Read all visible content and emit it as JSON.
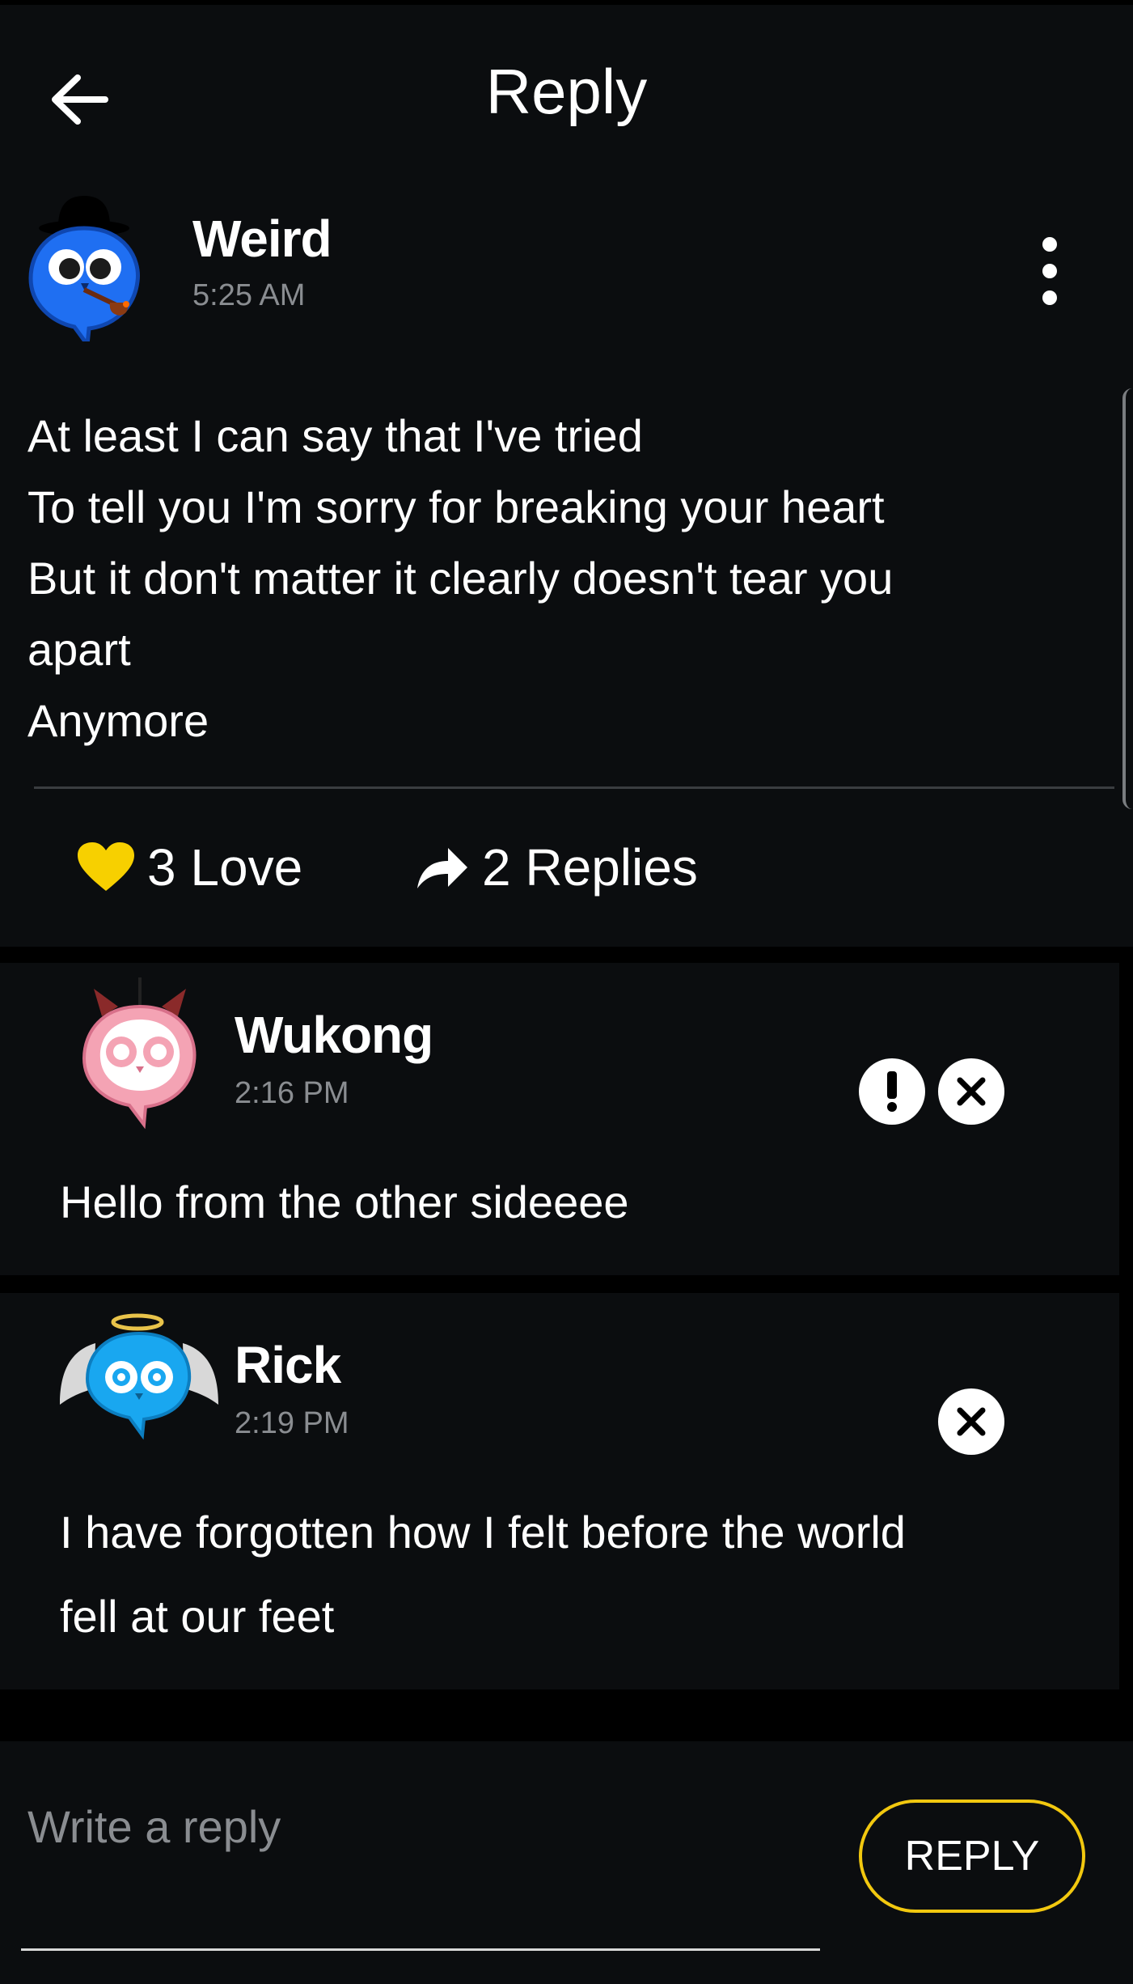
{
  "header": {
    "title": "Reply"
  },
  "post": {
    "author": "Weird",
    "time": "5:25 AM",
    "lines": [
      "At least I can say that I've tried",
      "To tell you I'm sorry for breaking your heart",
      "But it don't matter it clearly doesn't tear you",
      "apart",
      "Anymore"
    ],
    "love_label": "3 Love",
    "replies_label": "2 Replies"
  },
  "replies": [
    {
      "author": "Wukong",
      "time": "2:16 PM",
      "lines": [
        "Hello from the other sideeee"
      ],
      "actions": [
        "report-icon",
        "close-icon"
      ]
    },
    {
      "author": "Rick",
      "time": "2:19 PM",
      "lines": [
        "I have forgotten how I felt before the world",
        "fell at our feet"
      ],
      "actions": [
        "close-icon"
      ]
    }
  ],
  "composer": {
    "placeholder": "Write a reply",
    "button_label": "REPLY"
  },
  "colors": {
    "accent": "#f2c80f",
    "heart": "#f7d000",
    "background": "#0b0d0f",
    "muted_text": "#8a8d91"
  }
}
